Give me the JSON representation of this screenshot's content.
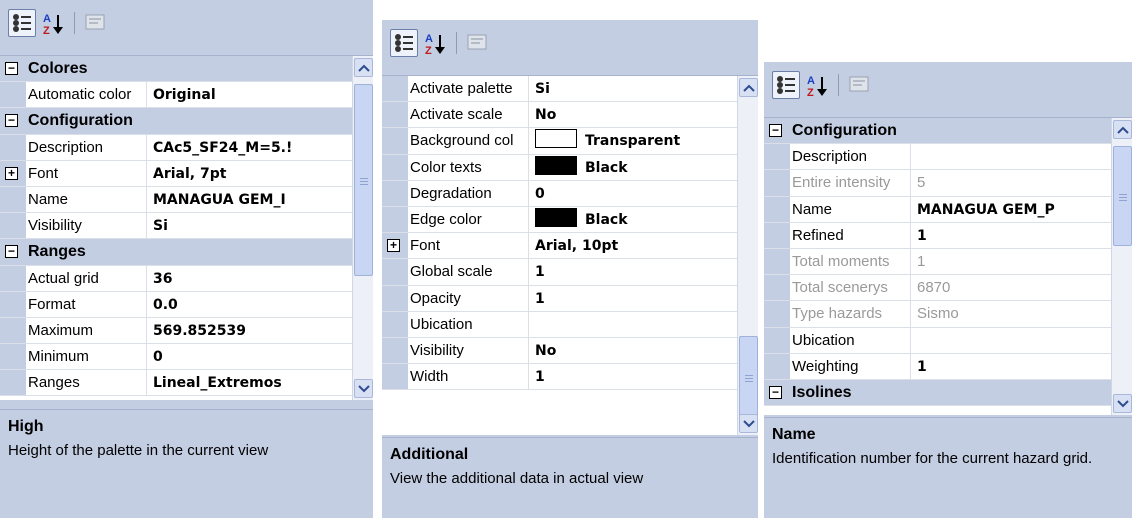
{
  "panels": [
    {
      "toolbar": {
        "categorized": "categorized-icon",
        "alphabetical": "sort-az-icon",
        "property_pages": "property-pages-icon"
      },
      "rows": [
        {
          "type": "category",
          "label": "Colores",
          "expanded": true
        },
        {
          "type": "prop",
          "name": "Automatic color",
          "value": "Original"
        },
        {
          "type": "category",
          "label": "Configuration",
          "expanded": true
        },
        {
          "type": "prop",
          "name": "Description",
          "value": "CAc5_SF24_M=5.!"
        },
        {
          "type": "prop",
          "name": "Font",
          "value": "Arial, 7pt",
          "expandable": true
        },
        {
          "type": "prop",
          "name": "Name",
          "value": "MANAGUA GEM_I"
        },
        {
          "type": "prop",
          "name": "Visibility",
          "value": "Si"
        },
        {
          "type": "category",
          "label": "Ranges",
          "expanded": true
        },
        {
          "type": "prop",
          "name": "Actual grid",
          "value": "36"
        },
        {
          "type": "prop",
          "name": "Format",
          "value": "0.0"
        },
        {
          "type": "prop",
          "name": "Maximum",
          "value": "569.852539"
        },
        {
          "type": "prop",
          "name": "Minimum",
          "value": "0"
        },
        {
          "type": "prop",
          "name": "Ranges",
          "value": "Lineal_Extremos"
        }
      ],
      "help": {
        "title": "High",
        "description": "Height of the palette in the current view"
      }
    },
    {
      "toolbar": {
        "categorized": "categorized-icon",
        "alphabetical": "sort-az-icon",
        "property_pages": "property-pages-icon"
      },
      "rows": [
        {
          "type": "prop",
          "name": "Activate palette",
          "value": "Si"
        },
        {
          "type": "prop",
          "name": "Activate scale",
          "value": "No"
        },
        {
          "type": "prop",
          "name": "Background col",
          "value": "Transparent",
          "swatch": "#ffffff"
        },
        {
          "type": "prop",
          "name": "Color texts",
          "value": "Black",
          "swatch": "#000000"
        },
        {
          "type": "prop",
          "name": "Degradation",
          "value": "0"
        },
        {
          "type": "prop",
          "name": "Edge color",
          "value": "Black",
          "swatch": "#000000"
        },
        {
          "type": "prop",
          "name": "Font",
          "value": "Arial, 10pt",
          "expandable": true
        },
        {
          "type": "prop",
          "name": "Global scale",
          "value": "1"
        },
        {
          "type": "prop",
          "name": "Opacity",
          "value": "1"
        },
        {
          "type": "prop",
          "name": "Ubication",
          "value": ""
        },
        {
          "type": "prop",
          "name": "Visibility",
          "value": "No"
        },
        {
          "type": "prop",
          "name": "Width",
          "value": "1"
        }
      ],
      "help": {
        "title": "Additional",
        "description": "View the additional data in actual view"
      }
    },
    {
      "toolbar": {
        "categorized": "categorized-icon",
        "alphabetical": "sort-az-icon",
        "property_pages": "property-pages-icon"
      },
      "rows": [
        {
          "type": "category",
          "label": "Configuration",
          "expanded": true
        },
        {
          "type": "prop",
          "name": "Description",
          "value": ""
        },
        {
          "type": "prop",
          "name": "Entire intensity",
          "value": "5",
          "disabled": true
        },
        {
          "type": "prop",
          "name": "Name",
          "value": "MANAGUA GEM_P"
        },
        {
          "type": "prop",
          "name": "Refined",
          "value": "1"
        },
        {
          "type": "prop",
          "name": "Total moments",
          "value": "1",
          "disabled": true
        },
        {
          "type": "prop",
          "name": "Total scenerys",
          "value": "6870",
          "disabled": true
        },
        {
          "type": "prop",
          "name": "Type hazards",
          "value": "Sismo",
          "disabled": true
        },
        {
          "type": "prop",
          "name": "Ubication",
          "value": ""
        },
        {
          "type": "prop",
          "name": "Weighting",
          "value": "1"
        },
        {
          "type": "category",
          "label": "Isolines",
          "expanded": true
        }
      ],
      "help": {
        "title": "Name",
        "description": "Identification number for the current hazard grid."
      }
    }
  ],
  "colors": {
    "chrome": "#c4cee3",
    "grid_line": "#dadfe8",
    "disabled_text": "#9a9a9a"
  }
}
